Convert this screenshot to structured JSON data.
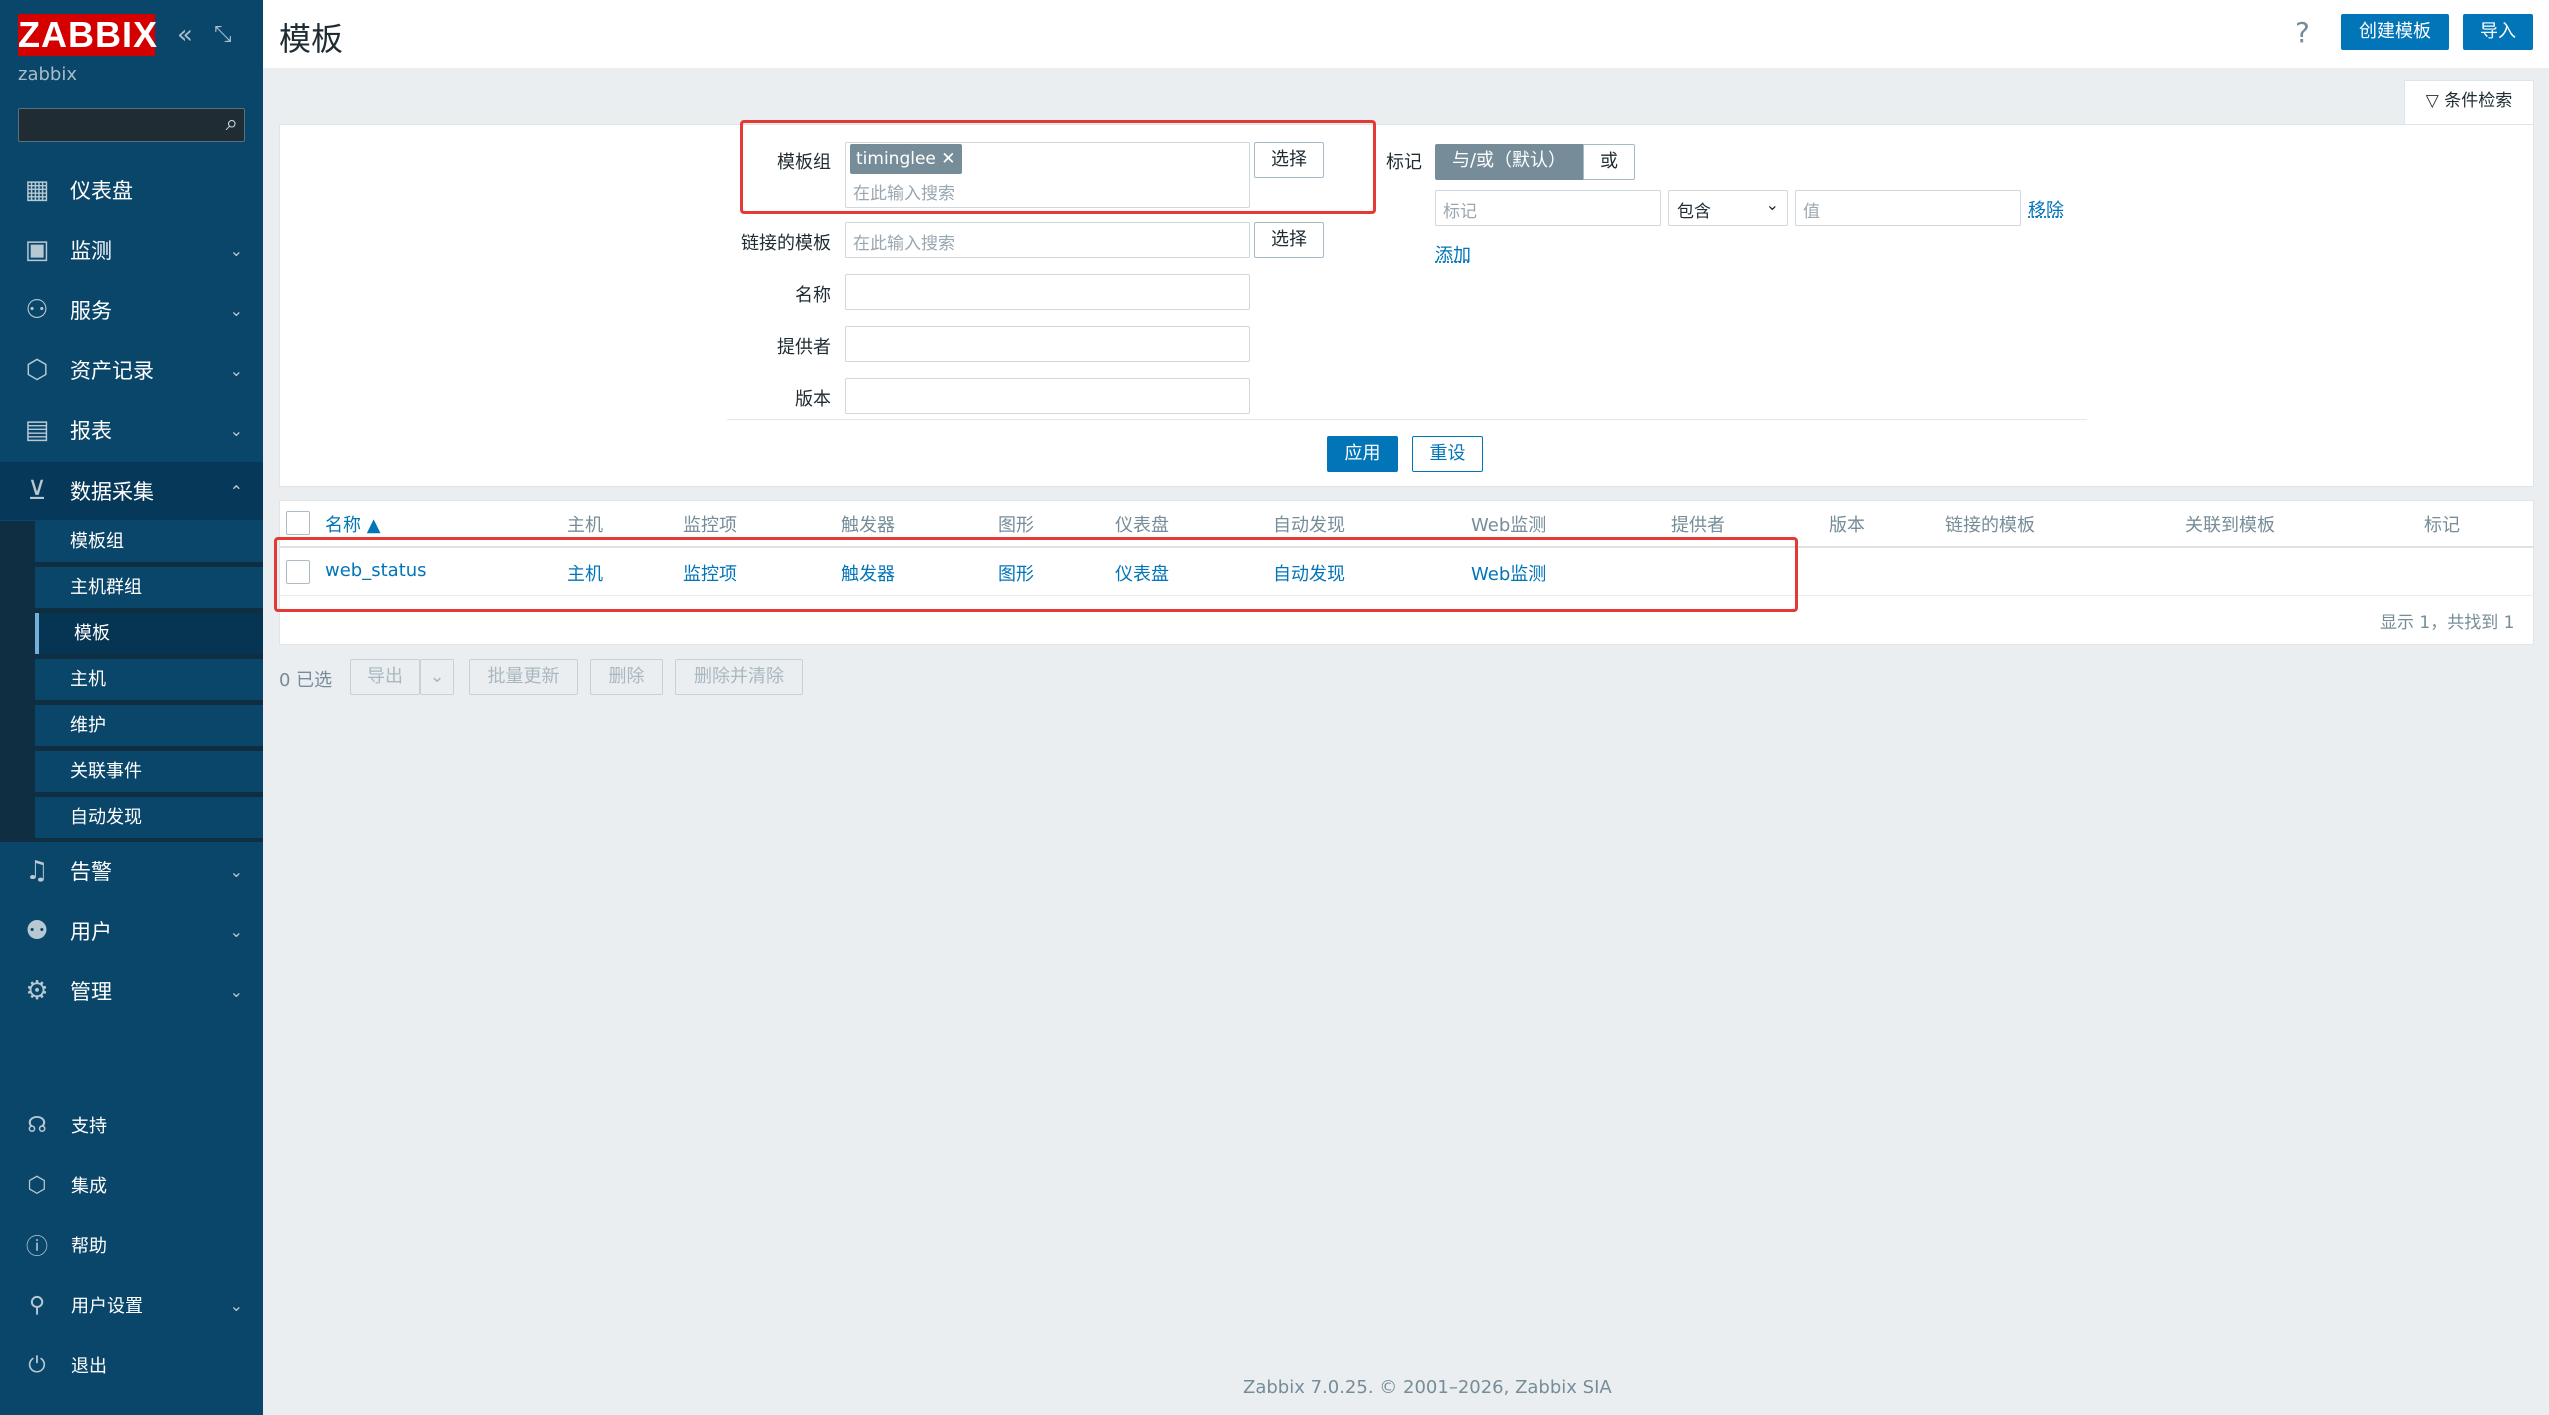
{
  "app": {
    "logo": "ZABBIX",
    "server": "zabbix",
    "collapse_icon": "double-chevron-left",
    "kiosk_icon": "expand-icon"
  },
  "sidebar": {
    "menu": [
      {
        "label": "仪表盘",
        "icon": "dashboard-icon"
      },
      {
        "label": "监测",
        "icon": "monitoring-icon"
      },
      {
        "label": "服务",
        "icon": "services-icon"
      },
      {
        "label": "资产记录",
        "icon": "inventory-icon"
      },
      {
        "label": "报表",
        "icon": "reports-icon"
      },
      {
        "label": "数据采集",
        "icon": "data-collection-icon"
      },
      {
        "label": "告警",
        "icon": "alerts-icon"
      },
      {
        "label": "用户",
        "icon": "users-icon"
      },
      {
        "label": "管理",
        "icon": "administration-icon"
      }
    ],
    "submenu": [
      "模板组",
      "主机群组",
      "模板",
      "主机",
      "维护",
      "关联事件",
      "自动发现"
    ],
    "bottom": [
      {
        "label": "支持",
        "icon": "support-icon"
      },
      {
        "label": "集成",
        "icon": "integrations-icon"
      },
      {
        "label": "帮助",
        "icon": "help-icon"
      },
      {
        "label": "用户设置",
        "icon": "user-settings-icon"
      },
      {
        "label": "退出",
        "icon": "power-icon"
      }
    ]
  },
  "header": {
    "title": "模板",
    "help": "?",
    "create_button": "创建模板",
    "import_button": "导入"
  },
  "filter": {
    "tab_label": "条件检索",
    "template_group_label": "模板组",
    "template_group_chip": "timinglee",
    "search_placeholder": "在此输入搜索",
    "select_button": "选择",
    "linked_templates_label": "链接的模板",
    "name_label": "名称",
    "vendor_label": "提供者",
    "version_label": "版本",
    "tags_label": "标记",
    "and_or_label": "与/或（默认）",
    "or_label": "或",
    "tag_placeholder": "标记",
    "operator_value": "包含",
    "value_placeholder": "值",
    "remove_link": "移除",
    "add_link": "添加",
    "apply_button": "应用",
    "reset_button": "重设"
  },
  "table": {
    "headers": [
      "名称 ▲",
      "主机",
      "监控项",
      "触发器",
      "图形",
      "仪表盘",
      "自动发现",
      "Web监测",
      "提供者",
      "版本",
      "链接的模板",
      "关联到模板",
      "标记"
    ],
    "rows": [
      {
        "name": "web_status",
        "hosts": "主机",
        "items": "监控项",
        "triggers": "触发器",
        "graphs": "图形",
        "dashboards": "仪表盘",
        "discovery": "自动发现",
        "web": "Web监测"
      }
    ],
    "summary": "显示 1，共找到 1"
  },
  "actions": {
    "selected": "0 已选",
    "export": "导出",
    "mass_update": "批量更新",
    "delete": "删除",
    "delete_clear": "删除并清除"
  },
  "footer": {
    "copyright": "Zabbix 7.0.25. © 2001–2026, Zabbix SIA"
  }
}
